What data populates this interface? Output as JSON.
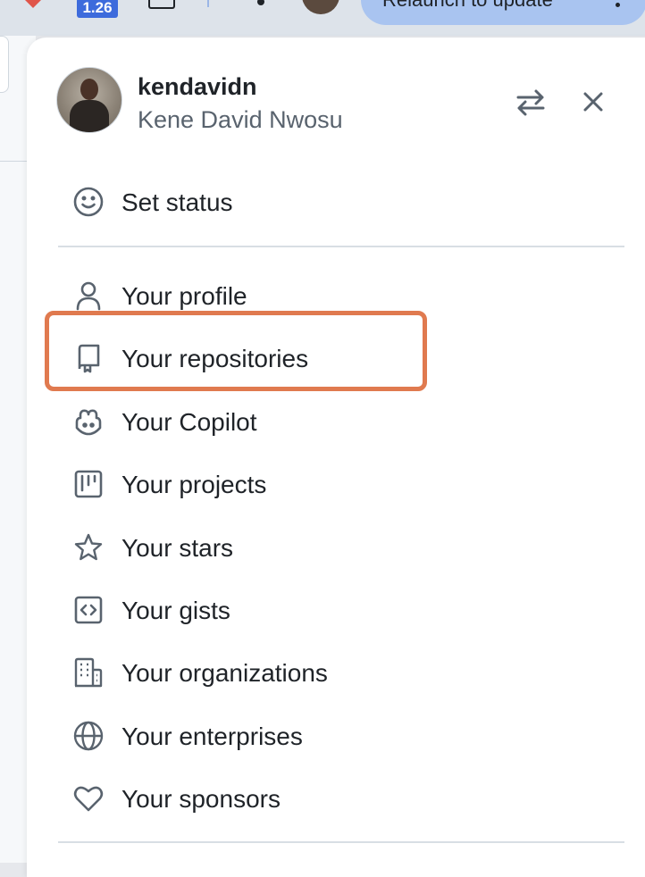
{
  "browser": {
    "badge_text": "1.26",
    "relaunch_label": "Relaunch to update"
  },
  "profile": {
    "username": "kendavidn",
    "full_name": "Kene David Nwosu"
  },
  "header_icons": {
    "switch": "arrow-switch-icon",
    "close": "x-icon"
  },
  "status": {
    "label": "Set status",
    "icon": "smiley-icon"
  },
  "menu": {
    "items": [
      {
        "label": "Your profile",
        "icon": "person-icon"
      },
      {
        "label": "Your repositories",
        "icon": "repo-icon"
      },
      {
        "label": "Your Copilot",
        "icon": "copilot-icon"
      },
      {
        "label": "Your projects",
        "icon": "table-icon"
      },
      {
        "label": "Your stars",
        "icon": "star-icon"
      },
      {
        "label": "Your gists",
        "icon": "code-square-icon"
      },
      {
        "label": "Your organizations",
        "icon": "organization-icon"
      },
      {
        "label": "Your enterprises",
        "icon": "globe-icon"
      },
      {
        "label": "Your sponsors",
        "icon": "heart-icon"
      }
    ]
  },
  "annotation": {
    "highlight_color": "#e07a4f",
    "highlighted_item": "Your repositories"
  },
  "colors": {
    "text": "#1f2328",
    "muted": "#59636e",
    "icon": "#59636e",
    "divider": "#d8dee4"
  }
}
